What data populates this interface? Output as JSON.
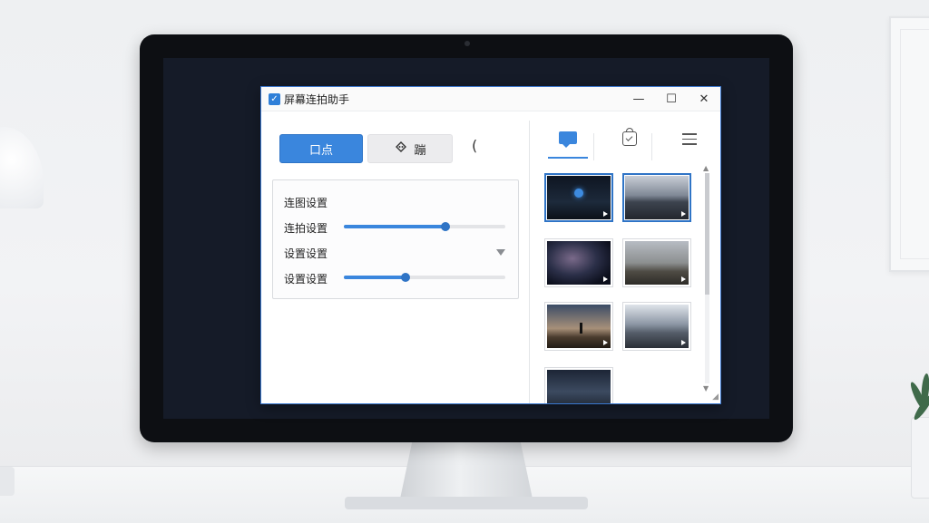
{
  "window": {
    "title": "屏幕连拍助手",
    "controls": {
      "minimize": "—",
      "maximize": "☐",
      "close": "✕"
    }
  },
  "toolbar": {
    "primary_label": "口点",
    "secondary_label": "蹦",
    "paren": "("
  },
  "settings": {
    "rows": [
      {
        "label": "连图设置"
      },
      {
        "label": "连拍设置",
        "slider_value": 0.63
      },
      {
        "label": "设置设置"
      },
      {
        "label": "设置设置",
        "slider_value": 0.38
      }
    ]
  },
  "tabs": [
    {
      "icon": "chat-icon",
      "active": true
    },
    {
      "icon": "bag-check-icon",
      "active": false
    },
    {
      "icon": "menu-icon",
      "active": false
    }
  ],
  "gallery": {
    "thumbnails": [
      {
        "scene": "dark-room",
        "selected": true
      },
      {
        "scene": "mountain-road",
        "selected": true
      },
      {
        "scene": "space-nebula",
        "selected": false
      },
      {
        "scene": "hills-dusk",
        "selected": false
      },
      {
        "scene": "desert-figure",
        "selected": false
      },
      {
        "scene": "road-mountains",
        "selected": false
      },
      {
        "scene": "night-mountains",
        "selected": false
      }
    ]
  },
  "colors": {
    "accent": "#3a86dd",
    "window_border": "#3b78d0",
    "screen_bg": "#151b28",
    "bezel": "#0d0f13"
  }
}
